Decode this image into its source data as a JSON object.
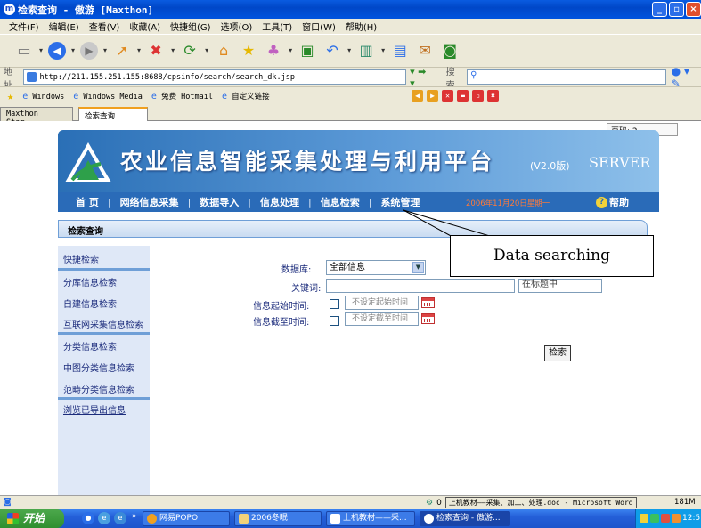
{
  "window": {
    "title": "检索查询 - 傲游 [Maxthon]",
    "icon": "maxthon-icon"
  },
  "menu": [
    "文件(F)",
    "编辑(E)",
    "查看(V)",
    "收藏(A)",
    "快捷组(G)",
    "选项(O)",
    "工具(T)",
    "窗口(W)",
    "帮助(H)"
  ],
  "address": {
    "label": "地址",
    "url": "http://211.155.251.155:8688/cpsinfo/search/search_dk.jsp",
    "search_label": "搜索",
    "search_value": ""
  },
  "links": [
    "Windows",
    "Windows Media",
    "免费 Hotmail",
    "自定义链接"
  ],
  "tabs": [
    {
      "label": "Maxthon Star...",
      "active": false
    },
    {
      "label": "检索查询",
      "active": true
    }
  ],
  "page_indicator": "页码: 2",
  "banner": {
    "title": "农业信息智能采集处理与利用平台",
    "version": "(V2.0版)",
    "server": "SERVER"
  },
  "nav": {
    "items": [
      "首 页",
      "网络信息采集",
      "数据导入",
      "信息处理",
      "信息检索",
      "系统管理"
    ],
    "date": "2006年11月20日星期一",
    "help": "帮助"
  },
  "section_title": "检索查询",
  "sidebar": {
    "group1": [
      "快捷检索"
    ],
    "group2": [
      "分库信息检索",
      "自建信息检索",
      "互联网采集信息检索"
    ],
    "group3": [
      "分类信息检索",
      "中图分类信息检索",
      "范畴分类信息检索"
    ],
    "group4": [
      "浏览已导出信息"
    ]
  },
  "form": {
    "database_label": "数据库:",
    "database_value": "全部信息",
    "keyword_label": "关键词:",
    "keyword_value": "",
    "scope_value": "在标题中",
    "start_time_label": "信息起始时间:",
    "start_time_placeholder": "不设定起始时间",
    "end_time_label": "信息截至时间:",
    "end_time_placeholder": "不设定截至时间",
    "search_button": "检索"
  },
  "annotation": "Data searching",
  "status": {
    "count": "0",
    "document": "上机教材——采集、加工、处理.doc - Microsoft Word",
    "memory": "181M"
  },
  "taskbar": {
    "start": "开始",
    "tasks": [
      "网易POPO",
      "2006冬眠",
      "上机教材——采...",
      "检索查询 - 傲游..."
    ],
    "clock": "12:57"
  },
  "colors": {
    "banner": "#2a6fb6",
    "nav": "#2a6bb8",
    "sidebar": "#dfe8f7",
    "date": "#ff7a3a"
  }
}
